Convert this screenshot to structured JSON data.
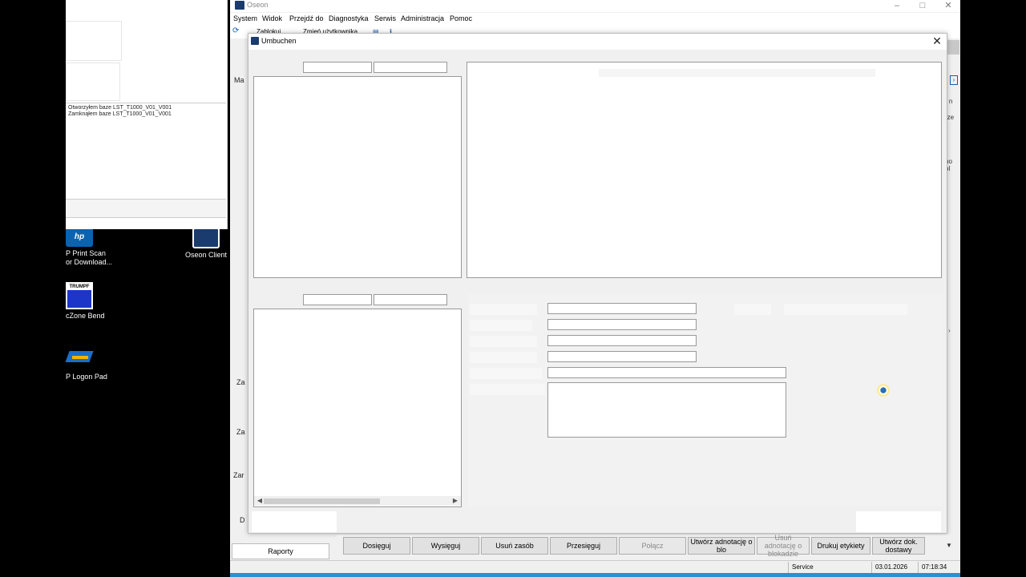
{
  "desktop": {
    "icons": [
      {
        "label_line1": "P Print Scan",
        "label_line2": "or Download...",
        "color": "#0a63b0"
      },
      {
        "label_line1": "Oseon Client",
        "label_line2": "",
        "color": "#1a3b6e"
      },
      {
        "label_line1": "cZone Bend",
        "label_line2": "",
        "brand": "TRUMPF",
        "color": "#1b36c9"
      },
      {
        "label_line1": "P Logon Pad",
        "label_line2": "",
        "color": "#1a6ec8"
      }
    ]
  },
  "logwindow": {
    "lines": [
      "Otworzyłem baze LST_T1000_V01_V001",
      "Zamknąłem baze LST_T1000_V01_V001"
    ]
  },
  "app": {
    "title": "Oseon",
    "menu": [
      "System",
      "Widok",
      "Przejdź do",
      "Diagnostyka",
      "Serwis",
      "Administracja",
      "Pomoc"
    ],
    "toolbar": {
      "lock": "Zablokuj",
      "change_user": "Zmień użytkownika"
    },
    "bg_labels": [
      "Ma",
      "Za",
      "Za",
      "Zar",
      "D"
    ],
    "right_strip": [
      "r n",
      "rze",
      "no",
      "bl"
    ],
    "reports": "Raporty",
    "status": {
      "user": "Service",
      "date": "03.01.2026",
      "time": "07:18:34"
    }
  },
  "dialog": {
    "title": "Umbuchen"
  },
  "buttons": [
    {
      "label": "Dosięguj",
      "disabled": false
    },
    {
      "label": "Wysięguj",
      "disabled": false
    },
    {
      "label": "Usuń zasób",
      "disabled": false
    },
    {
      "label": "Przesięguj",
      "disabled": false
    },
    {
      "label": "Połącz",
      "disabled": true
    },
    {
      "label": "Utwórz adnotację o blo",
      "disabled": false
    },
    {
      "label": "Usuń adnotację o blokadzie",
      "disabled": true
    },
    {
      "label": "Drukuj etykiety",
      "disabled": false
    },
    {
      "label": "Utwórz dok. dostawy",
      "disabled": false
    }
  ]
}
